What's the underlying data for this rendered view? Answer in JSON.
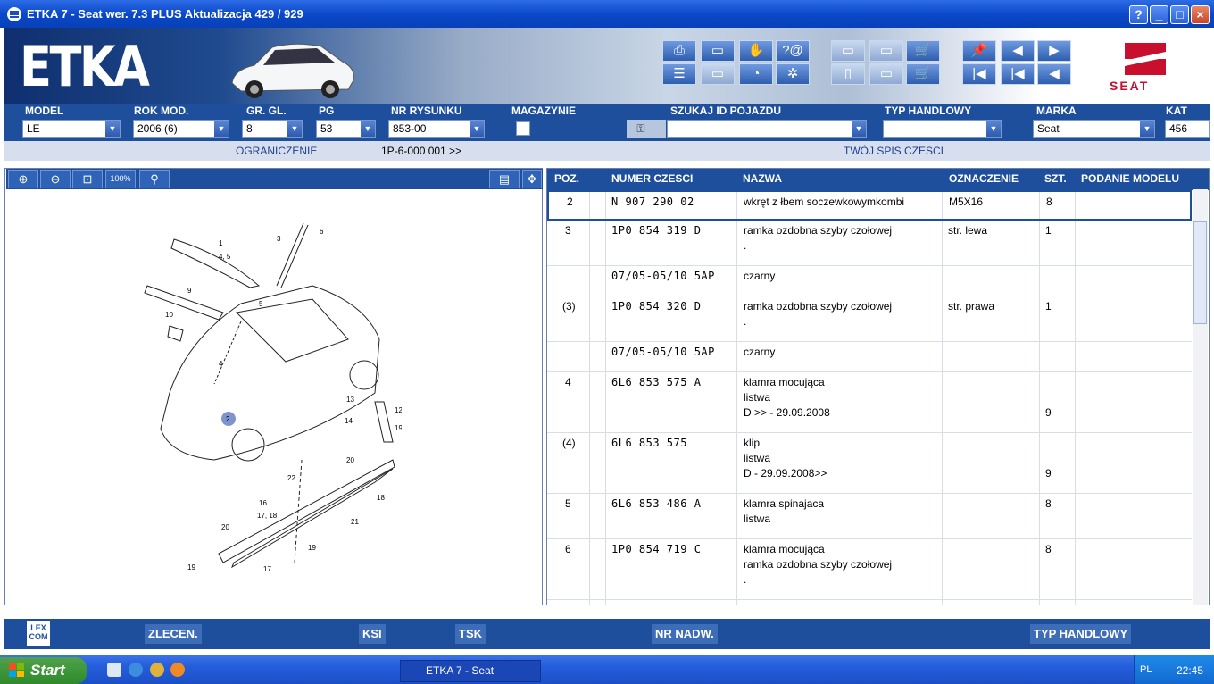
{
  "window": {
    "title": "ETKA 7 - Seat wer. 7.3 PLUS Aktualizacja 429 / 929"
  },
  "app": {
    "logo": "ETKA",
    "brand_logo_text": "SEAT"
  },
  "selectors": {
    "model": {
      "label": "MODEL",
      "value": "LE"
    },
    "rok": {
      "label": "ROK MOD.",
      "value": "2006 (6)"
    },
    "gr": {
      "label": "GR. GL.",
      "value": "8"
    },
    "pg": {
      "label": "PG",
      "value": "53"
    },
    "nr": {
      "label": "NR RYSUNKU",
      "value": "853-00"
    },
    "magazynie": {
      "label": "MAGAZYNIE"
    },
    "szukaj": {
      "label": "SZUKAJ ID POJAZDU",
      "value": ""
    },
    "typ": {
      "label": "TYP HANDLOWY",
      "value": ""
    },
    "marka": {
      "label": "MARKA",
      "value": "Seat"
    },
    "kat": {
      "label": "KAT",
      "value": "456"
    }
  },
  "infobar": {
    "ograniczenie": "OGRANICZENIE",
    "range": "1P-6-000 001 >>",
    "spis": "TWÓJ SPIS CZESCI"
  },
  "table": {
    "headers": {
      "poz": "POZ.",
      "numer": "NUMER CZESCI",
      "nazwa": "NAZWA",
      "oznaczenie": "OZNACZENIE",
      "szt": "SZT.",
      "podanie": "PODANIE MODELU"
    },
    "rows": [
      {
        "poz": "2",
        "numer": "N   907 290 02",
        "nazwa": "wkręt z łbem soczewkowymkombi",
        "ozn": "M5X16",
        "szt": "8"
      },
      {
        "poz": "3",
        "numer": "1P0 854 319 D",
        "nazwa": "ramka ozdobna szyby czołowej\n.",
        "ozn": "str. lewa",
        "szt": "1"
      },
      {
        "poz": "",
        "numer": "07/05-05/10 5AP",
        "nazwa": "czarny",
        "ozn": "",
        "szt": ""
      },
      {
        "poz": "(3)",
        "numer": "1P0 854 320 D",
        "nazwa": "ramka ozdobna szyby czołowej\n.",
        "ozn": "str. prawa",
        "szt": "1"
      },
      {
        "poz": "",
        "numer": "07/05-05/10 5AP",
        "nazwa": "czarny",
        "ozn": "",
        "szt": ""
      },
      {
        "poz": "4",
        "numer": "6L6 853 575 A",
        "nazwa": "klamra mocująca\nlistwa\nD              >> - 29.09.2008",
        "ozn": "",
        "szt": "\n\n9"
      },
      {
        "poz": "(4)",
        "numer": "6L6 853 575",
        "nazwa": "klip\nlistwa\nD - 29.09.2008>>",
        "ozn": "",
        "szt": "\n\n9"
      },
      {
        "poz": "5",
        "numer": "6L6 853 486 A",
        "nazwa": "klamra spinajaca\nlistwa",
        "ozn": "",
        "szt": "8"
      },
      {
        "poz": "6",
        "numer": "1P0 854 719 C",
        "nazwa": "klamra mocująca\nramka ozdobna szyby czołowej\n.",
        "ozn": "",
        "szt": "8"
      }
    ]
  },
  "bottombar": {
    "zlecen": "ZLECEN.",
    "ksi": "KSI",
    "tsk": "TSK",
    "nr_nadw": "NR NADW.",
    "typ": "TYP HANDLOWY",
    "lexcom": "LEX\nCOM"
  },
  "taskbar": {
    "start": "Start",
    "task_item": "ETKA 7 - Seat",
    "lang": "PL",
    "clock": "22:45"
  },
  "drawing_labels": [
    "1",
    "4, 5",
    "3",
    "6",
    "9",
    "5",
    "10",
    "4",
    "2",
    "13",
    "12",
    "14",
    "19",
    "20",
    "18",
    "22",
    "16",
    "17, 18",
    "21",
    "20",
    "19",
    "19",
    "17"
  ]
}
